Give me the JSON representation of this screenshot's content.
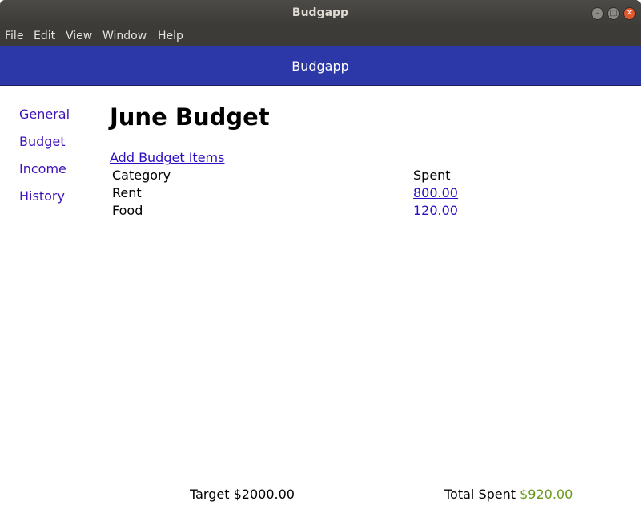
{
  "window": {
    "title": "Budgapp",
    "controls": [
      "minimize-icon",
      "maximize-icon",
      "close-icon"
    ]
  },
  "menubar": [
    "File",
    "Edit",
    "View",
    "Window",
    "Help"
  ],
  "header": {
    "title": "Budgapp"
  },
  "sidebar": {
    "items": [
      "General",
      "Budget",
      "Income",
      "History"
    ]
  },
  "main": {
    "title": "June Budget",
    "add_link": "Add Budget Items",
    "table": {
      "headers": [
        "Category",
        "Spent"
      ],
      "rows": [
        [
          "Rent",
          "800.00"
        ],
        [
          "Food",
          "120.00"
        ]
      ]
    }
  },
  "footer": {
    "target_label": "Target",
    "target_value": "$2000.00",
    "spent_label": "Total Spent",
    "spent_value": "$920.00",
    "spent_color": "#6b9a1c"
  }
}
